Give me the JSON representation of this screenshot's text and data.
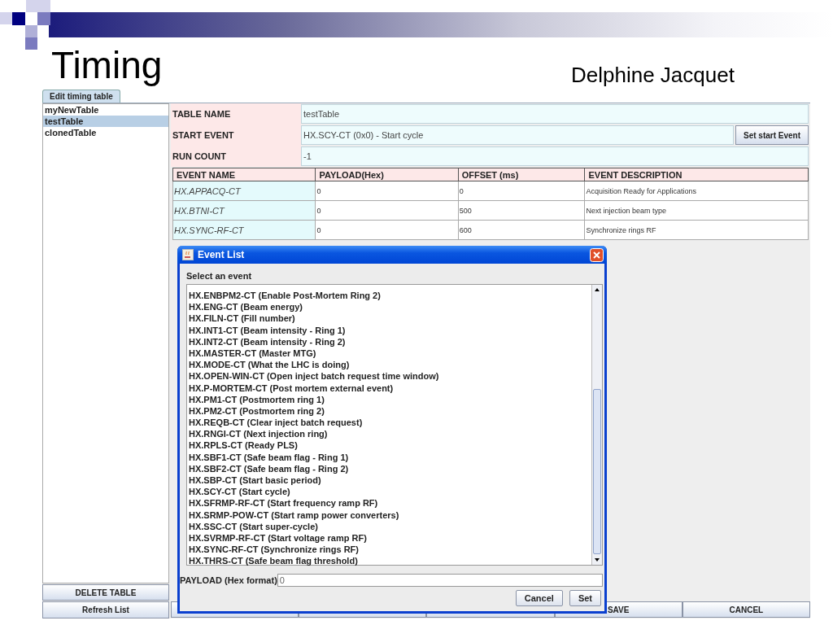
{
  "slide": {
    "title": "Timing",
    "author": "Delphine Jacquet"
  },
  "app": {
    "tabs": [
      {
        "label": "Edit timing table",
        "selected": true
      }
    ],
    "tables": [
      {
        "name": "myNewTable",
        "selected": false
      },
      {
        "name": "testTable",
        "selected": true
      },
      {
        "name": "clonedTable",
        "selected": false
      }
    ],
    "delete_button": "DELETE TABLE",
    "refresh_button": "Refresh List",
    "form": [
      {
        "label": "TABLE NAME",
        "value": "testTable"
      },
      {
        "label": "START EVENT",
        "value": "HX.SCY-CT (0x0) - Start cycle",
        "button": "Set start Event"
      },
      {
        "label": "RUN COUNT",
        "value": "-1"
      }
    ],
    "events_table": {
      "columns": [
        "EVENT NAME",
        "PAYLOAD(Hex)",
        "OFFSET (ms)",
        "EVENT DESCRIPTION"
      ],
      "rows": [
        [
          "HX.APPACQ-CT",
          "0",
          "0",
          "Acquisition Ready for Applications"
        ],
        [
          "HX.BTNI-CT",
          "0",
          "500",
          "Next injection beam type"
        ],
        [
          "HX.SYNC-RF-CT",
          "0",
          "600",
          "Synchronize rings RF"
        ]
      ]
    },
    "bottom_buttons": [
      {
        "kind": "covered"
      },
      {
        "kind": "covered"
      },
      {
        "kind": "covered"
      },
      {
        "kind": "text",
        "label": "SAVE"
      },
      {
        "kind": "text",
        "label": "CANCEL"
      }
    ],
    "dialog": {
      "title": "Event List",
      "prompt": "Select an event",
      "events": [
        "HX.ENBPM2-CT (Enable Post-Mortem Ring 2)",
        "HX.ENG-CT (Beam energy)",
        "HX.FILN-CT (Fill number)",
        "HX.INT1-CT (Beam intensity - Ring 1)",
        "HX.INT2-CT (Beam intensity - Ring 2)",
        "HX.MASTER-CT (Master MTG)",
        "HX.MODE-CT (What the LHC is doing)",
        "HX.OPEN-WIN-CT (Open  inject batch request time window)",
        "HX.P-MORTEM-CT (Post mortem external event)",
        "HX.PM1-CT (Postmortem ring 1)",
        "HX.PM2-CT (Postmortem ring 2)",
        "HX.REQB-CT (Clear inject batch request)",
        "HX.RNGI-CT (Next injection ring)",
        "HX.RPLS-CT (Ready PLS)",
        "HX.SBF1-CT (Safe beam flag - Ring 1)",
        "HX.SBF2-CT (Safe beam flag - Ring 2)",
        "HX.SBP-CT (Start basic period)",
        "HX.SCY-CT (Start cycle)",
        "HX.SFRMP-RF-CT (Start frequency ramp RF)",
        "HX.SRMP-POW-CT (Start ramp power converters)",
        "HX.SSC-CT (Start super-cycle)",
        "HX.SVRMP-RF-CT (Start voltage ramp RF)",
        "HX.SYNC-RF-CT (Synchronize rings RF)",
        "HX.THRS-CT (Safe beam flag threshold)"
      ],
      "payload_label": "PAYLOAD (Hex format)",
      "payload_value": "0",
      "buttons": [
        "Cancel",
        "Set"
      ]
    }
  }
}
